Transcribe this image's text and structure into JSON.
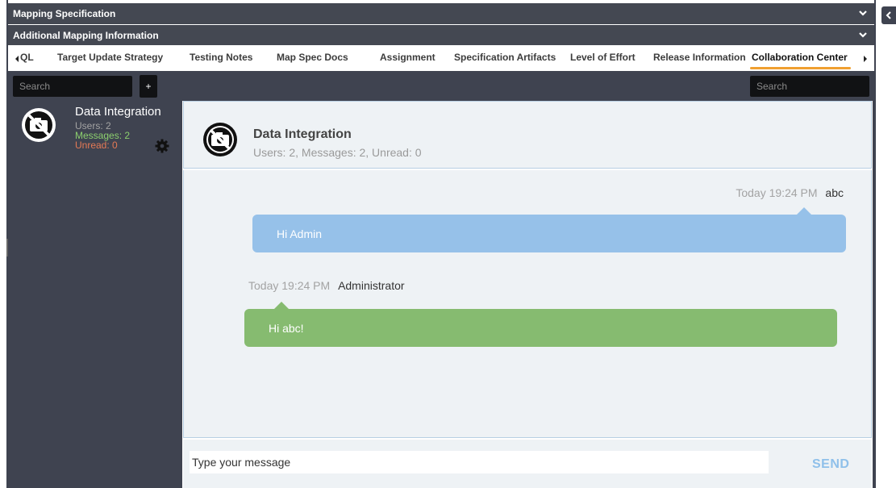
{
  "sections": {
    "mapping_spec": "Mapping Specification",
    "additional_info": "Additional Mapping Information"
  },
  "tabs": [
    {
      "label": "QL"
    },
    {
      "label": "Target Update Strategy"
    },
    {
      "label": "Testing Notes"
    },
    {
      "label": "Map Spec Docs"
    },
    {
      "label": "Assignment"
    },
    {
      "label": "Specification Artifacts"
    },
    {
      "label": "Level of Effort"
    },
    {
      "label": "Release Information"
    },
    {
      "label": "Collaboration Center",
      "active": true
    }
  ],
  "sidebar": {
    "search_placeholder": "Search",
    "add_label": "+",
    "room": {
      "name": "Data Integration",
      "users": "Users: 2",
      "messages": "Messages: 2",
      "unread": "Unread: 0"
    }
  },
  "chat": {
    "search_placeholder": "Search",
    "header_title": "Data Integration",
    "header_stats": "Users: 2, Messages: 2, Unread: 0",
    "messages": [
      {
        "time": "Today 19:24 PM",
        "author": "abc",
        "text": "Hi Admin",
        "color": "#96c1e9"
      },
      {
        "time": "Today 19:24 PM",
        "author": "Administrator",
        "text": "Hi abc!",
        "color": "#86bb70"
      }
    ],
    "input_placeholder": "Type your message",
    "send_label": "SEND"
  },
  "colors": {
    "dark_panel": "#3f4350",
    "section_bar": "#444852",
    "tab_underline": "#f0a030",
    "messages_label": "#8ccf6e",
    "unread_label": "#e57a55",
    "send": "#8fc0ea"
  },
  "icons": [
    "chevron-down-icon",
    "chevron-left-icon",
    "chevron-right-icon",
    "no-photo-icon",
    "gear-icon",
    "plus-icon"
  ]
}
